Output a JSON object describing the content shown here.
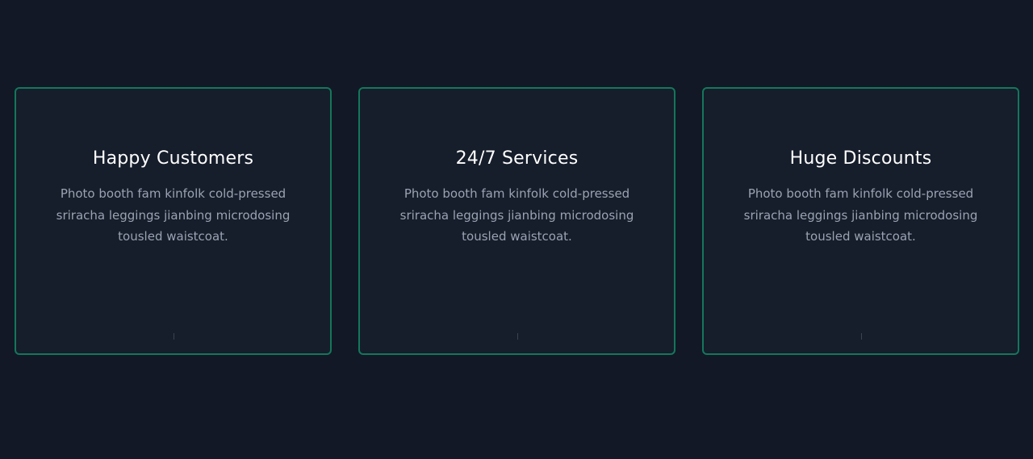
{
  "features": {
    "cards": [
      {
        "title": "Happy Customers",
        "text": "Photo booth fam kinfolk cold-pressed sriracha leggings jianbing microdosing tousled waistcoat."
      },
      {
        "title": "24/7 Services",
        "text": "Photo booth fam kinfolk cold-pressed sriracha leggings jianbing microdosing tousled waistcoat."
      },
      {
        "title": "Huge Discounts",
        "text": "Photo booth fam kinfolk cold-pressed sriracha leggings jianbing microdosing tousled waistcoat."
      }
    ]
  },
  "colors": {
    "background": "#121826",
    "card_background": "#161d2b",
    "card_border": "#13775a",
    "title": "#ffffff",
    "body_text": "#9aa3b2"
  }
}
